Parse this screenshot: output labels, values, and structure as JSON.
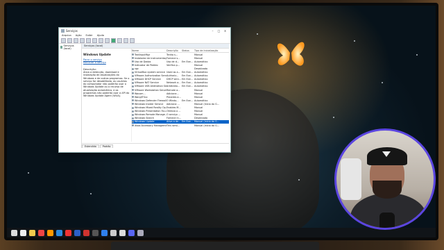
{
  "window": {
    "title": "Serviços",
    "menu": [
      "Arquivo",
      "Ação",
      "Exibir",
      "Ajuda"
    ],
    "nav_item": "Serviços (local)",
    "header": "Serviços (local)",
    "service_title": "Windows Update",
    "links": [
      "Parar o serviço",
      "Reiniciar o serviço"
    ],
    "desc_label": "Descrição:",
    "desc_body": "Ativa a detecção, download e instalação de atualizações do Windows e de outros programas. Se o serviço for desabilitado, os usuários do computador não poderão usar o Windows Update ou o recurso de atualização automática, e os programas não poderão usar a API do Windows Update Agent (WUA).",
    "columns": [
      "Nome",
      "Descrição",
      "Status",
      "Tipo de Inicialização"
    ],
    "rows": [
      [
        "TextInputMgr",
        "Tenha s...",
        "",
        "Manual"
      ],
      [
        "Instalador de instrumentação...",
        "Fornece s...",
        "",
        "Manual"
      ],
      [
        "Uso de Dados",
        "Uso de d...",
        "Em Exe...",
        "Automático"
      ],
      [
        "Indicador de Pedido",
        "Verifica p...",
        "",
        "Manual"
      ],
      [
        "vgc",
        "",
        "",
        "Desativado"
      ],
      [
        "VirtualBox system service",
        "Used as a...",
        "Em Exe...",
        "Automático"
      ],
      [
        "VMware Authorization Serv...",
        "Authoriz...",
        "Em Exe...",
        "Automático"
      ],
      [
        "VMware DHCP Service",
        "DHCP serv...",
        "Em Exe...",
        "Automático"
      ],
      [
        "VMware NAT Service",
        "Network a...",
        "Em Exe...",
        "Automático"
      ],
      [
        "VMware USB Arbitration Ser...",
        "Arbitratio...",
        "Em Exe...",
        "Automático"
      ],
      [
        "VMware Workstation Server",
        "Remote a...",
        "",
        "Manual"
      ],
      [
        "Wacom...",
        "Adicione...",
        "",
        "Manual"
      ],
      [
        "WarpJITSvc",
        "Provides a...",
        "",
        "Manual"
      ],
      [
        "Windows Defender Firewall",
        "O Windo...",
        "Em Exe...",
        "Automático"
      ],
      [
        "Windows Insider Service",
        "Adiciona ...",
        "",
        "Manual (Início do G..."
      ],
      [
        "Windows Mixed Reality Op...",
        "Enables M...",
        "",
        "Manual"
      ],
      [
        "Windows Presentation Fou...",
        "Otimiza o ...",
        "",
        "Manual"
      ],
      [
        "Windows Remote Manage...",
        "O serviço ...",
        "",
        "Manual"
      ],
      [
        "Windows Search",
        "Fornece in...",
        "",
        "Desativado"
      ],
      [
        "Windows Update",
        "Ativa a de...",
        "Em Exe...",
        "Manual (Início do G..."
      ],
      [
        "Xbox Accessory Manageme...",
        "This servi...",
        "",
        "Manual (Início do G..."
      ]
    ],
    "selected_row": 19,
    "tabs": [
      "Estendido",
      "Padrão"
    ]
  },
  "colors": {
    "accent": "#0a64c8",
    "webcam_ring": "#5b45e0"
  },
  "taskbar_icons": [
    "windows-icon",
    "search-icon",
    "file-explorer-icon",
    "chrome-icon",
    "firefox-icon",
    "edge-icon",
    "app-icon",
    "word-icon",
    "music-icon",
    "obs-icon",
    "vscode-icon",
    "pen-icon",
    "settings-icon",
    "discord-icon",
    "services-icon"
  ]
}
